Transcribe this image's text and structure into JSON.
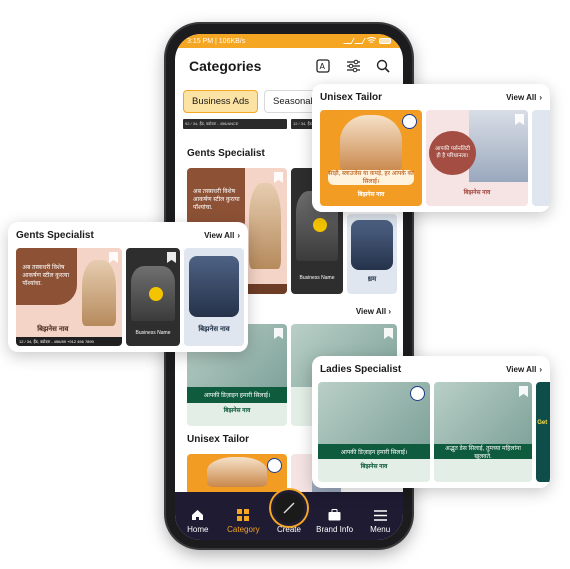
{
  "status": {
    "time": "3:15 PM | 106KB/s",
    "battery": "88"
  },
  "appbar": {
    "title": "Categories"
  },
  "chips": [
    {
      "label": "Business Ads",
      "active": true
    },
    {
      "label": "Seasonal Bu",
      "active": false
    }
  ],
  "strips": [
    "92 / 34, हैंड, वडोदरा - 456/ANCE",
    "12 / 34, हैंड, वडोदरा - 456/ANCE"
  ],
  "sections": {
    "gents": {
      "title": "Gents Specialist",
      "view_all": "View All"
    },
    "ladies": {
      "title": "Ladies Specialist",
      "view_all": "View All",
      "title_partial": "st"
    },
    "unisex": {
      "title": "Unisex Tailor",
      "view_all": "View All"
    }
  },
  "posters": {
    "gents_text": "अब तस्त्राधरी विशेष आकर्षण स्टील कुरत्या पॉश्यांचा.",
    "gents_brand": "बिझनेस नाव",
    "business_name": "Business Name",
    "suit_brand": "बिझनेस नाव",
    "ladies_band": "आपकी डिज़ाइन हमारी सिलाई।",
    "ladies_brand": "बिझनेस नाव",
    "ladies_band2": "अद्भुत डेस सिलाई, तुमच्या महिलांना खुलवते.",
    "unisex_band": "साड़ी, ब्लाउजेस या कपड़े, हर आपके का सिलाई।",
    "unisex_brand": "बिझनेस नाव",
    "unisex_circle": "आपकी पर्सनलिटी ही है परिधानला।",
    "unisex_brand2": "बिझनेस नाव",
    "contact": "12 / 34, हैंड, वडोदरा - 456/89   +912 456 7890",
    "teal_text": "Get",
    "partial_label": "ध्रम"
  },
  "nav": [
    {
      "label": "Home",
      "icon": "home-icon"
    },
    {
      "label": "Category",
      "icon": "category-icon",
      "active": true
    },
    {
      "label": "Create",
      "icon": "create-icon"
    },
    {
      "label": "Brand Info",
      "icon": "briefcase-icon"
    },
    {
      "label": "Menu",
      "icon": "menu-icon"
    }
  ],
  "colors": {
    "accent": "#f5a623",
    "nav_bg": "#1f1b33",
    "chip_active": "#fde3a3"
  }
}
